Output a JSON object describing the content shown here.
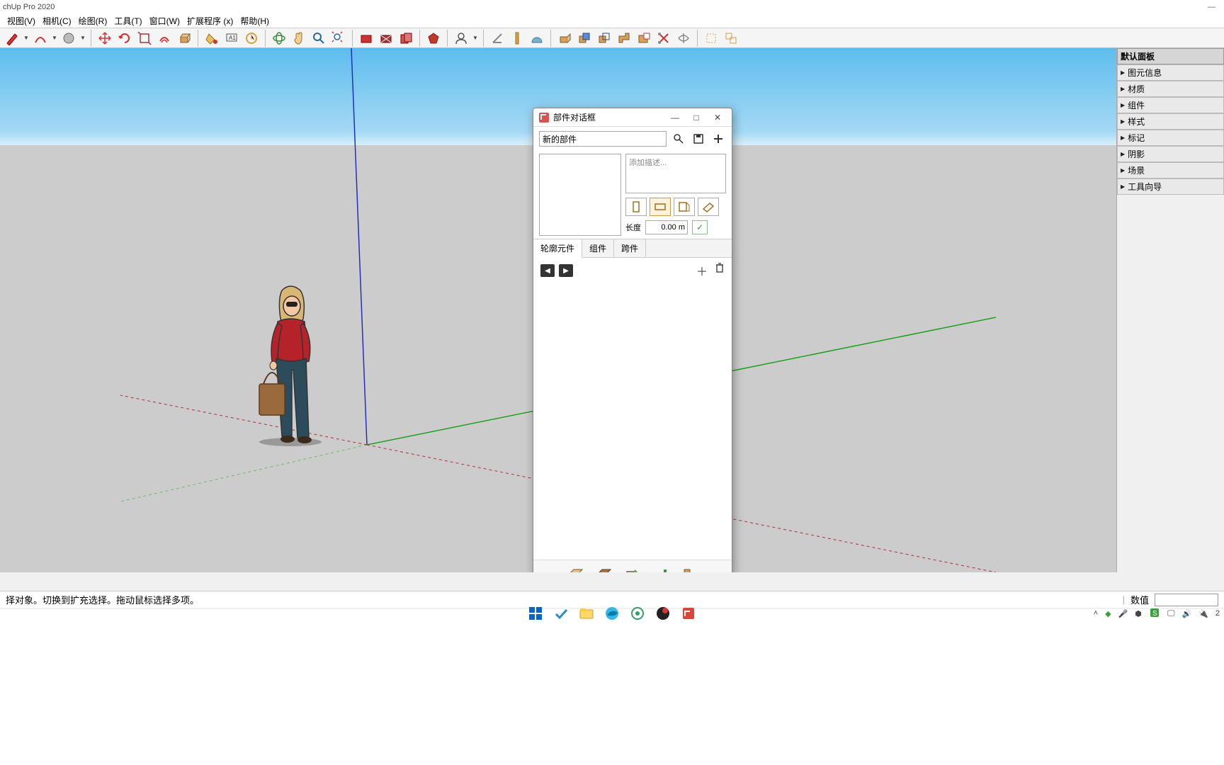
{
  "app": {
    "title": "chUp Pro 2020"
  },
  "menu": {
    "items": [
      "视图(V)",
      "相机(C)",
      "绘图(R)",
      "工具(T)",
      "窗口(W)",
      "扩展程序 (x)",
      "帮助(H)"
    ]
  },
  "toolbar": {
    "groups": [
      [
        "pencil",
        "arc",
        "circle"
      ],
      [
        "move",
        "rotate",
        "scale",
        "offset",
        "tape"
      ],
      [
        "paint-bucket",
        "text-label",
        "dimension"
      ],
      [
        "orbit",
        "pan",
        "zoom",
        "zoom-extents"
      ],
      [
        "section-plane",
        "section-display",
        "section-fill"
      ],
      [
        "ruby"
      ],
      [
        "user"
      ],
      [
        "axes-tool",
        "tape-measure",
        "protractor"
      ],
      [
        "pushpull",
        "follow-me",
        "intersect",
        "outer-shell",
        "solid-tools",
        "trim",
        "split",
        "explode"
      ],
      [
        "box-select",
        "lasso-select"
      ]
    ]
  },
  "side": {
    "header": "默认面板",
    "items": [
      "图元信息",
      "材质",
      "组件",
      "样式",
      "标记",
      "阴影",
      "场景",
      "工具向导"
    ]
  },
  "dialog": {
    "title": "部件对话框",
    "name_value": "新的部件",
    "desc_placeholder": "添加描述...",
    "length_label": "长度",
    "length_value": "0.00 m",
    "tabs": [
      "轮廓元件",
      "组件",
      "跨件"
    ]
  },
  "status": {
    "hint": "择对象。切换到扩充选择。拖动鼠标选择多项。",
    "value_label": "数值"
  },
  "tray": {
    "time": "2"
  }
}
